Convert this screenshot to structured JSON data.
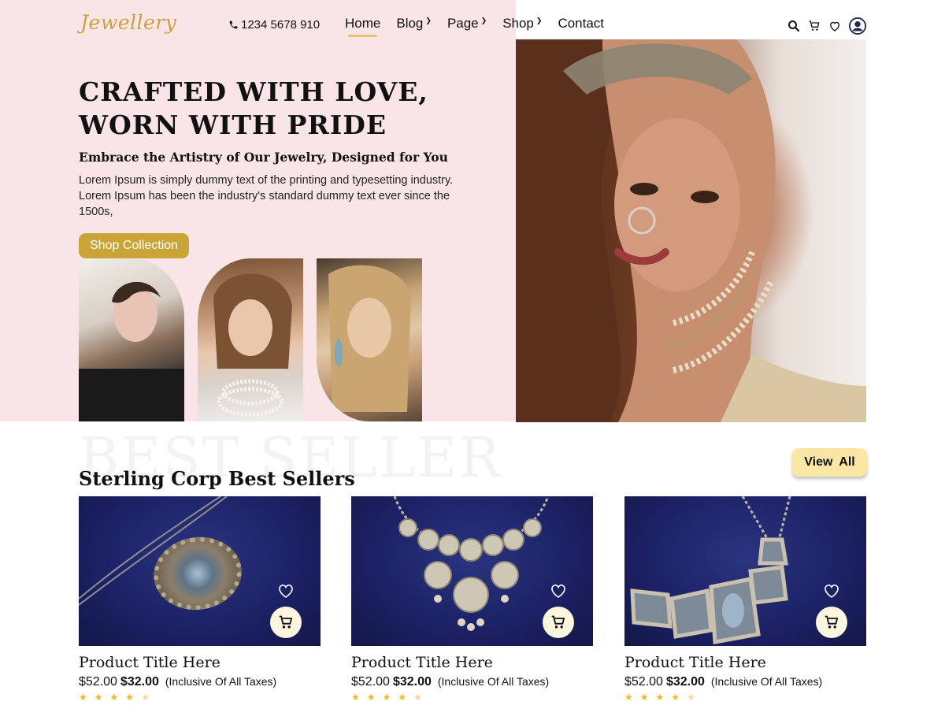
{
  "header": {
    "logo": "Jewellery",
    "phone": "1234 5678 910",
    "nav": [
      {
        "label": "Home",
        "active": true,
        "dropdown": false
      },
      {
        "label": "Blog",
        "active": false,
        "dropdown": true
      },
      {
        "label": "Page",
        "active": false,
        "dropdown": true
      },
      {
        "label": "Shop",
        "active": false,
        "dropdown": true
      },
      {
        "label": "Contact",
        "active": false,
        "dropdown": false
      }
    ],
    "icons": [
      "search-icon",
      "cart-icon",
      "heart-icon",
      "user-avatar-icon"
    ]
  },
  "hero": {
    "title_line1": "CRAFTED WITH LOVE,",
    "title_line2": "WORN WITH PRIDE",
    "subtitle": "Embrace the Artistry of Our Jewelry, Designed for You",
    "text": "Lorem Ipsum is simply dummy text of the printing and typesetting industry. Lorem Ipsum has been the industry's standard dummy text ever since the 1500s,",
    "button": "Shop Collection"
  },
  "best_sellers": {
    "background_word": "BEST SELLER",
    "title": "Sterling Corp Best Sellers",
    "view_all": "View All",
    "products": [
      {
        "title": "Product Title Here",
        "old_price": "$52.00",
        "price": "$32.00",
        "tax_note": "(Inclusive Of All Taxes)",
        "rating": 4.5
      },
      {
        "title": "Product Title Here",
        "old_price": "$52.00",
        "price": "$32.00",
        "tax_note": "(Inclusive Of All Taxes)",
        "rating": 4.5
      },
      {
        "title": "Product Title Here",
        "old_price": "$52.00",
        "price": "$32.00",
        "tax_note": "(Inclusive Of All Taxes)",
        "rating": 4.5
      }
    ]
  },
  "colors": {
    "hero_bg": "#f9e5e8",
    "gold_accent": "#c9a436",
    "view_all_bg": "#fbe7a5",
    "product_bg": "#1c2266",
    "star": "#f6b523"
  }
}
